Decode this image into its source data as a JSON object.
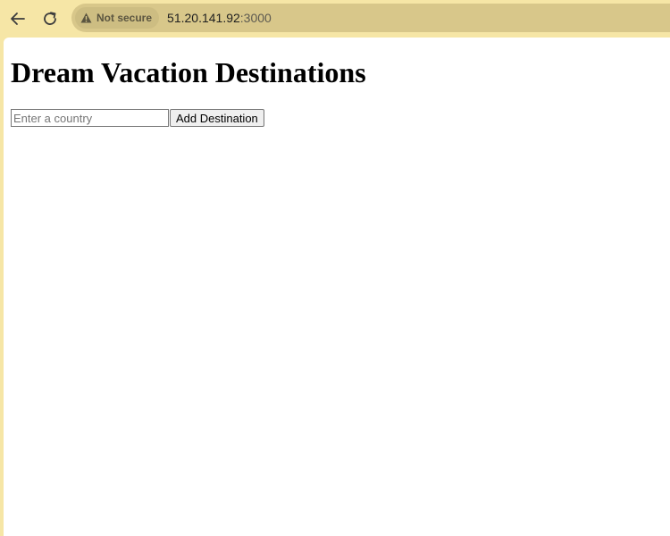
{
  "browser": {
    "security_label": "Not secure",
    "url_host": "51.20.141.92",
    "url_port": ":3000",
    "icons": {
      "back": "back-arrow-icon",
      "reload": "reload-icon",
      "security": "warning-triangle-icon"
    }
  },
  "page": {
    "title": "Dream Vacation Destinations",
    "input_placeholder": "Enter a country",
    "input_value": "",
    "add_button_label": "Add Destination"
  }
}
